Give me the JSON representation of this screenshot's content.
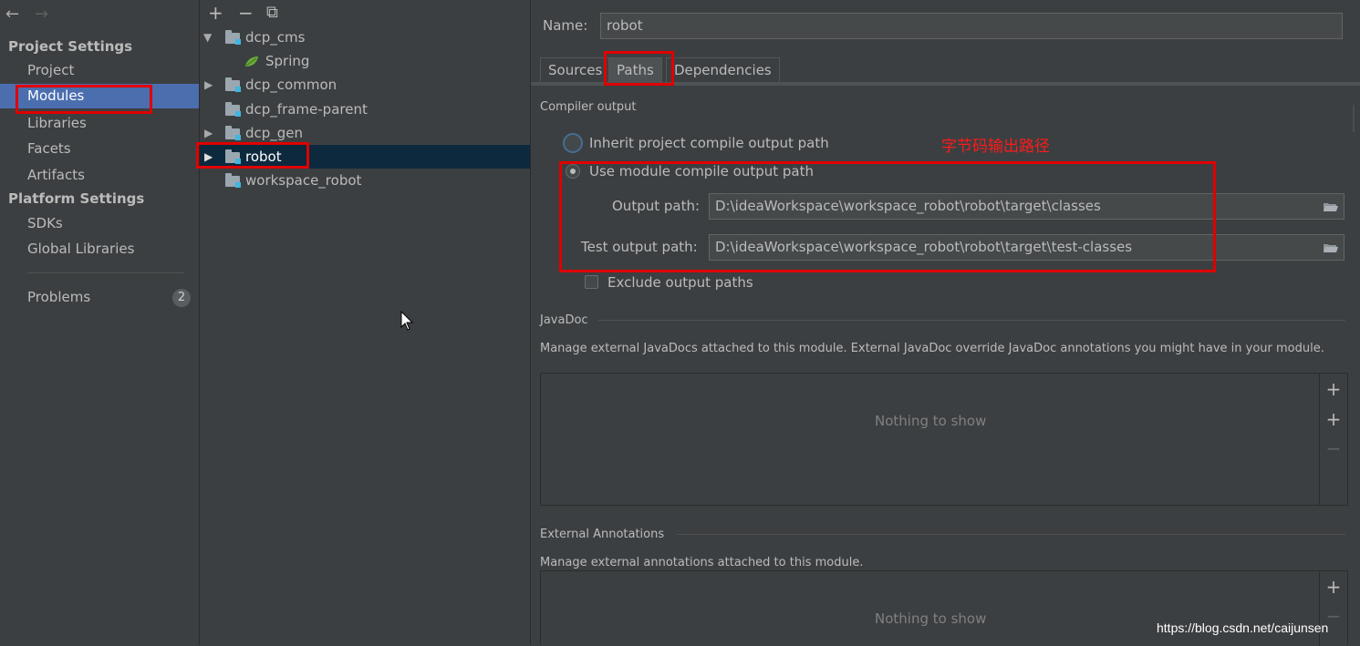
{
  "sidebar": {
    "back_icon": "←",
    "forward_icon": "→",
    "project_settings_header": "Project Settings",
    "platform_settings_header": "Platform Settings",
    "items": [
      {
        "label": "Project"
      },
      {
        "label": "Modules"
      },
      {
        "label": "Libraries"
      },
      {
        "label": "Facets"
      },
      {
        "label": "Artifacts"
      }
    ],
    "platform_items": [
      {
        "label": "SDKs"
      },
      {
        "label": "Global Libraries"
      }
    ],
    "problems_label": "Problems",
    "problems_count": "2"
  },
  "tree": {
    "toolbar": {
      "add": "+",
      "remove": "−",
      "copy": "⧉"
    },
    "nodes": [
      {
        "label": "dcp_cms",
        "expanded": true
      },
      {
        "label": "Spring"
      },
      {
        "label": "dcp_common",
        "expanded": false
      },
      {
        "label": "dcp_frame-parent"
      },
      {
        "label": "dcp_gen",
        "expanded": false
      },
      {
        "label": "robot",
        "expanded": false
      },
      {
        "label": "workspace_robot"
      }
    ],
    "expanded_glyph": "▼",
    "collapsed_glyph": "▶"
  },
  "module": {
    "name_label": "Name:",
    "name_value": "robot",
    "tabs": [
      {
        "label": "Sources"
      },
      {
        "label": "Paths"
      },
      {
        "label": "Dependencies"
      }
    ],
    "compiler_output": {
      "title": "Compiler output",
      "inherit_label": "Inherit project compile output path",
      "use_module_label": "Use module compile output path",
      "output_path_label": "Output path:",
      "output_path_value": "D:\\ideaWorkspace\\workspace_robot\\robot\\target\\classes",
      "test_output_path_label": "Test output path:",
      "test_output_path_value": "D:\\ideaWorkspace\\workspace_robot\\robot\\target\\test-classes",
      "exclude_label": "Exclude output paths"
    },
    "javadoc": {
      "title": "JavaDoc",
      "description": "Manage external JavaDocs attached to this module. External JavaDoc override JavaDoc annotations you might have in your module.",
      "empty_text": "Nothing to show"
    },
    "external_annotations": {
      "title": "External Annotations",
      "description": "Manage external annotations attached to this module.",
      "empty_text": "Nothing to show"
    },
    "list_tools": {
      "add": "+",
      "add_url": "+",
      "remove": "−"
    }
  },
  "annotation_text": "字节码输出路径",
  "watermark": "https://blog.csdn.net/caijunsen",
  "colors": {
    "selection": "#4b6eaf",
    "tree_selection": "#0d293e",
    "annotation_red": "#e00000"
  }
}
